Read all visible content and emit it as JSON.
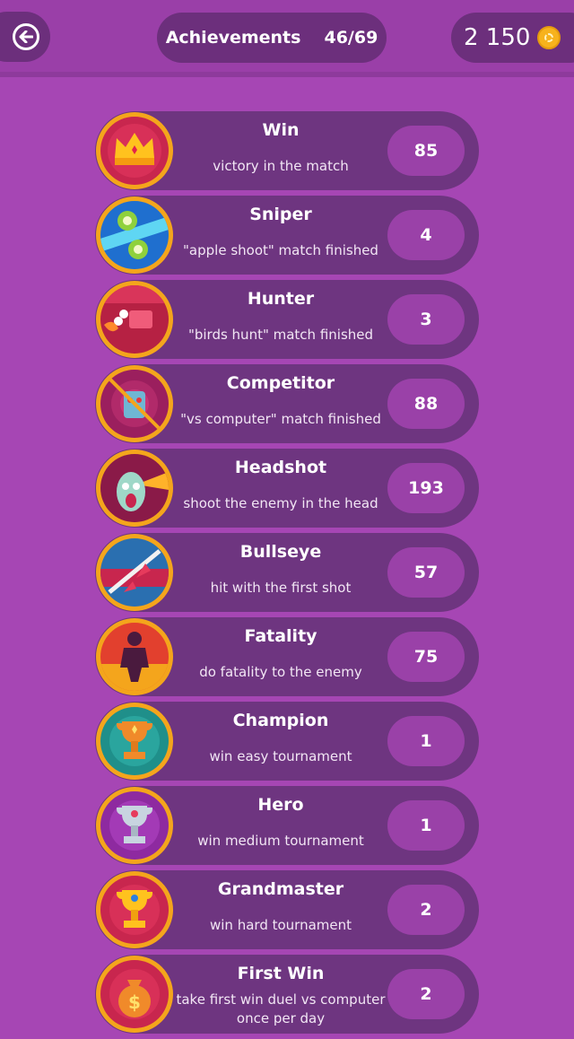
{
  "header": {
    "title": "Achievements",
    "progress": "46/69",
    "coins": "2 150"
  },
  "achievements": [
    {
      "name": "Win",
      "desc": "victory in the match",
      "count": "85",
      "icon": "crown-icon"
    },
    {
      "name": "Sniper",
      "desc": "\"apple shoot\" match finished",
      "count": "4",
      "icon": "apple-shot-icon"
    },
    {
      "name": "Hunter",
      "desc": "\"birds hunt\" match finished",
      "count": "3",
      "icon": "bird-hunt-icon"
    },
    {
      "name": "Competitor",
      "desc": "\"vs computer\" match finished",
      "count": "88",
      "icon": "robot-icon"
    },
    {
      "name": "Headshot",
      "desc": "shoot the enemy in the head",
      "count": "193",
      "icon": "zombie-headshot-icon"
    },
    {
      "name": "Bullseye",
      "desc": "hit with the first shot",
      "count": "57",
      "icon": "arrow-target-icon"
    },
    {
      "name": "Fatality",
      "desc": "do fatality to the enemy",
      "count": "75",
      "icon": "fatality-icon"
    },
    {
      "name": "Champion",
      "desc": "win easy tournament",
      "count": "1",
      "icon": "bronze-trophy-icon"
    },
    {
      "name": "Hero",
      "desc": "win medium tournament",
      "count": "1",
      "icon": "silver-trophy-icon"
    },
    {
      "name": "Grandmaster",
      "desc": "win hard tournament",
      "count": "2",
      "icon": "gold-trophy-icon"
    },
    {
      "name": "First Win",
      "desc": "take first win duel vs computer once per day",
      "count": "2",
      "icon": "money-bag-icon"
    }
  ]
}
